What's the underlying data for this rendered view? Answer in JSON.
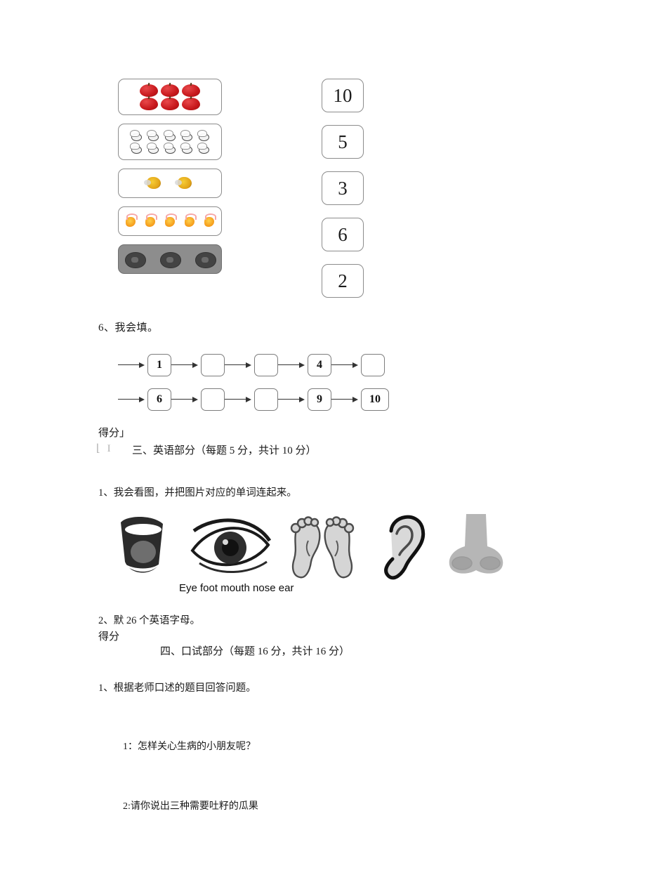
{
  "matching": {
    "picture_groups": [
      {
        "id": "apples",
        "count": 6,
        "item": "apple",
        "answer": 6
      },
      {
        "id": "bees",
        "count": 10,
        "item": "bee",
        "answer": 10
      },
      {
        "id": "flowers",
        "count": 2,
        "item": "butterfly-flower",
        "answer": 2
      },
      {
        "id": "chicks",
        "count": 5,
        "item": "orange-creature",
        "answer": 5
      },
      {
        "id": "animals",
        "count": 3,
        "item": "dark-animal",
        "answer": 3
      }
    ],
    "number_options": [
      "10",
      "5",
      "3",
      "6",
      "2"
    ]
  },
  "question6": {
    "title": "6、我会填。",
    "rows": [
      {
        "cells": [
          "1",
          "",
          "",
          "4",
          ""
        ]
      },
      {
        "cells": [
          "6",
          "",
          "",
          "9",
          "10"
        ]
      }
    ]
  },
  "section3": {
    "score_label": "得分」",
    "score_bracket": "⌊ I",
    "title": "三、英语部分（每题 5 分，共计 10 分）",
    "q1": "1、我会看图，并把图片对应的单词连起来。",
    "word_list": "Eye foot mouth nose ear",
    "pictures": [
      "mouth",
      "eye",
      "foot",
      "ear",
      "nose"
    ],
    "q2": "2、默 26 个英语字母。"
  },
  "section4": {
    "score_label": "得分",
    "title": "四、口试部分（每题 16 分，共计 16 分）",
    "q1": "1、根据老师口述的题目回答问题。",
    "oral_questions": [
      "1：怎样关心生病的小朋友呢？",
      "2:请你说出三种需要吐籽的瓜果"
    ]
  },
  "colors": {
    "page_background": "#ffffff",
    "text": "#1a1a1a",
    "box_border": "#8c8c8c",
    "apple_red": "#c7181c",
    "orange": "#f59a19",
    "dark_gray": "#8d8d8d"
  }
}
